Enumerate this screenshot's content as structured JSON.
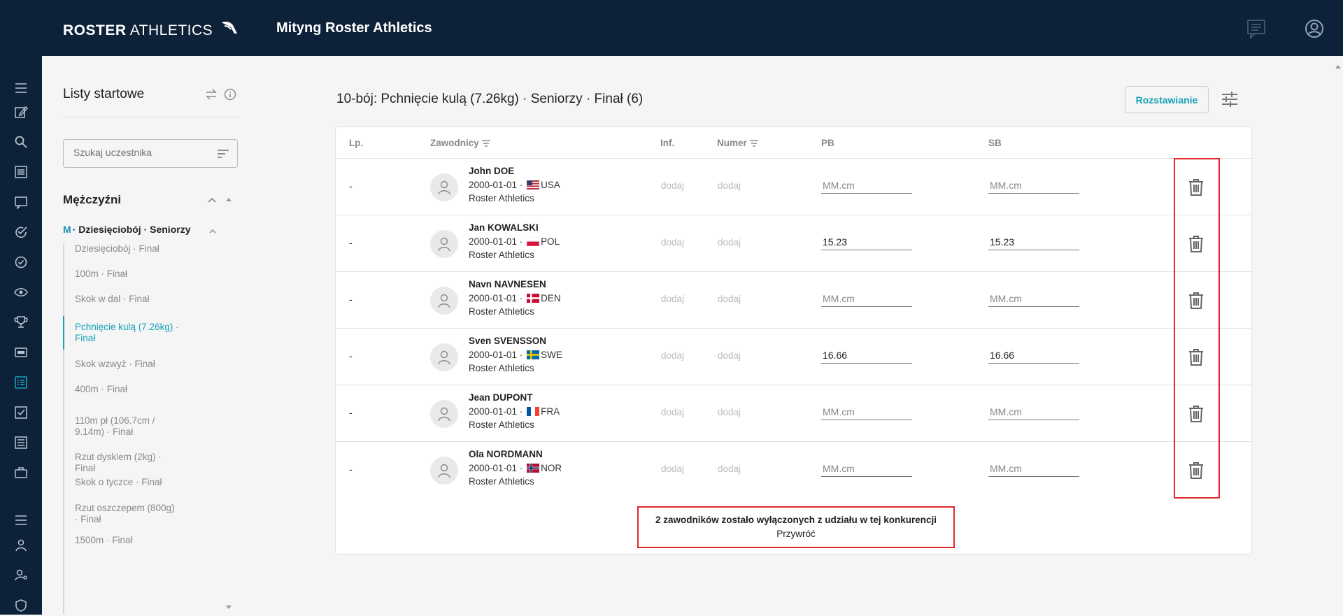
{
  "header": {
    "brand_bold": "ROSTER",
    "brand_light": "ATHLETICS",
    "meet_title": "Mityng Roster Athletics"
  },
  "sidebar": {
    "title": "Listy startowe",
    "search_placeholder": "Szukaj uczestnika",
    "group_title": "Mężczyźni",
    "sub_prefix": "M",
    "sub_title": "· Dziesięciobój · Seniorzy",
    "events": [
      {
        "label": "Dziesięciobój · Finał",
        "active": false
      },
      {
        "label": "100m · Finał",
        "active": false
      },
      {
        "label": "Skok w dal · Finał",
        "active": false
      },
      {
        "label": "Pchnięcie kulą (7.26kg) · Finał",
        "active": true
      },
      {
        "label": "Skok wzwyż · Finał",
        "active": false
      },
      {
        "label": "400m · Finał",
        "active": false
      },
      {
        "label": "110m pł (106.7cm / 9.14m) · Finał",
        "active": false
      },
      {
        "label": "Rzut dyskiem (2kg) · Finał",
        "active": false
      },
      {
        "label": "Skok o tyczce · Finał",
        "active": false
      },
      {
        "label": "Rzut oszczepem (800g) · Finał",
        "active": false
      },
      {
        "label": "1500m · Finał",
        "active": false
      }
    ]
  },
  "main": {
    "title": "10-bój: Pchnięcie kulą (7.26kg) · Seniorzy · Finał (6)",
    "seeding_button": "Rozstawianie",
    "columns": {
      "lp": "Lp.",
      "athletes": "Zawodnicy",
      "inf": "Inf.",
      "number": "Numer",
      "pb": "PB",
      "sb": "SB"
    },
    "mark_placeholder": "MM.cm",
    "rows": [
      {
        "lp": "-",
        "name": "John DOE",
        "dob": "2000-01-01 ·",
        "country": "USA",
        "club": "Roster Athletics",
        "inf": "dodaj",
        "number": "dodaj",
        "pb": "",
        "sb": ""
      },
      {
        "lp": "-",
        "name": "Jan KOWALSKI",
        "dob": "2000-01-01 ·",
        "country": "POL",
        "club": "Roster Athletics",
        "inf": "dodaj",
        "number": "dodaj",
        "pb": "15.23",
        "sb": "15.23"
      },
      {
        "lp": "-",
        "name": "Navn NAVNESEN",
        "dob": "2000-01-01 ·",
        "country": "DEN",
        "club": "Roster Athletics",
        "inf": "dodaj",
        "number": "dodaj",
        "pb": "",
        "sb": ""
      },
      {
        "lp": "-",
        "name": "Sven SVENSSON",
        "dob": "2000-01-01 ·",
        "country": "SWE",
        "club": "Roster Athletics",
        "inf": "dodaj",
        "number": "dodaj",
        "pb": "16.66",
        "sb": "16.66"
      },
      {
        "lp": "-",
        "name": "Jean DUPONT",
        "dob": "2000-01-01 ·",
        "country": "FRA",
        "club": "Roster Athletics",
        "inf": "dodaj",
        "number": "dodaj",
        "pb": "",
        "sb": ""
      },
      {
        "lp": "-",
        "name": "Ola NORDMANN",
        "dob": "2000-01-01 ·",
        "country": "NOR",
        "club": "Roster Athletics",
        "inf": "dodaj",
        "number": "dodaj",
        "pb": "",
        "sb": ""
      }
    ],
    "excluded_message": "2 zawodników zostało wyłączonych z udziału w tej konkurencji",
    "restore_label": "Przywróć"
  },
  "colors": {
    "navy": "#0d2238",
    "accent": "#17a2b8",
    "highlight": "#e0282e"
  }
}
